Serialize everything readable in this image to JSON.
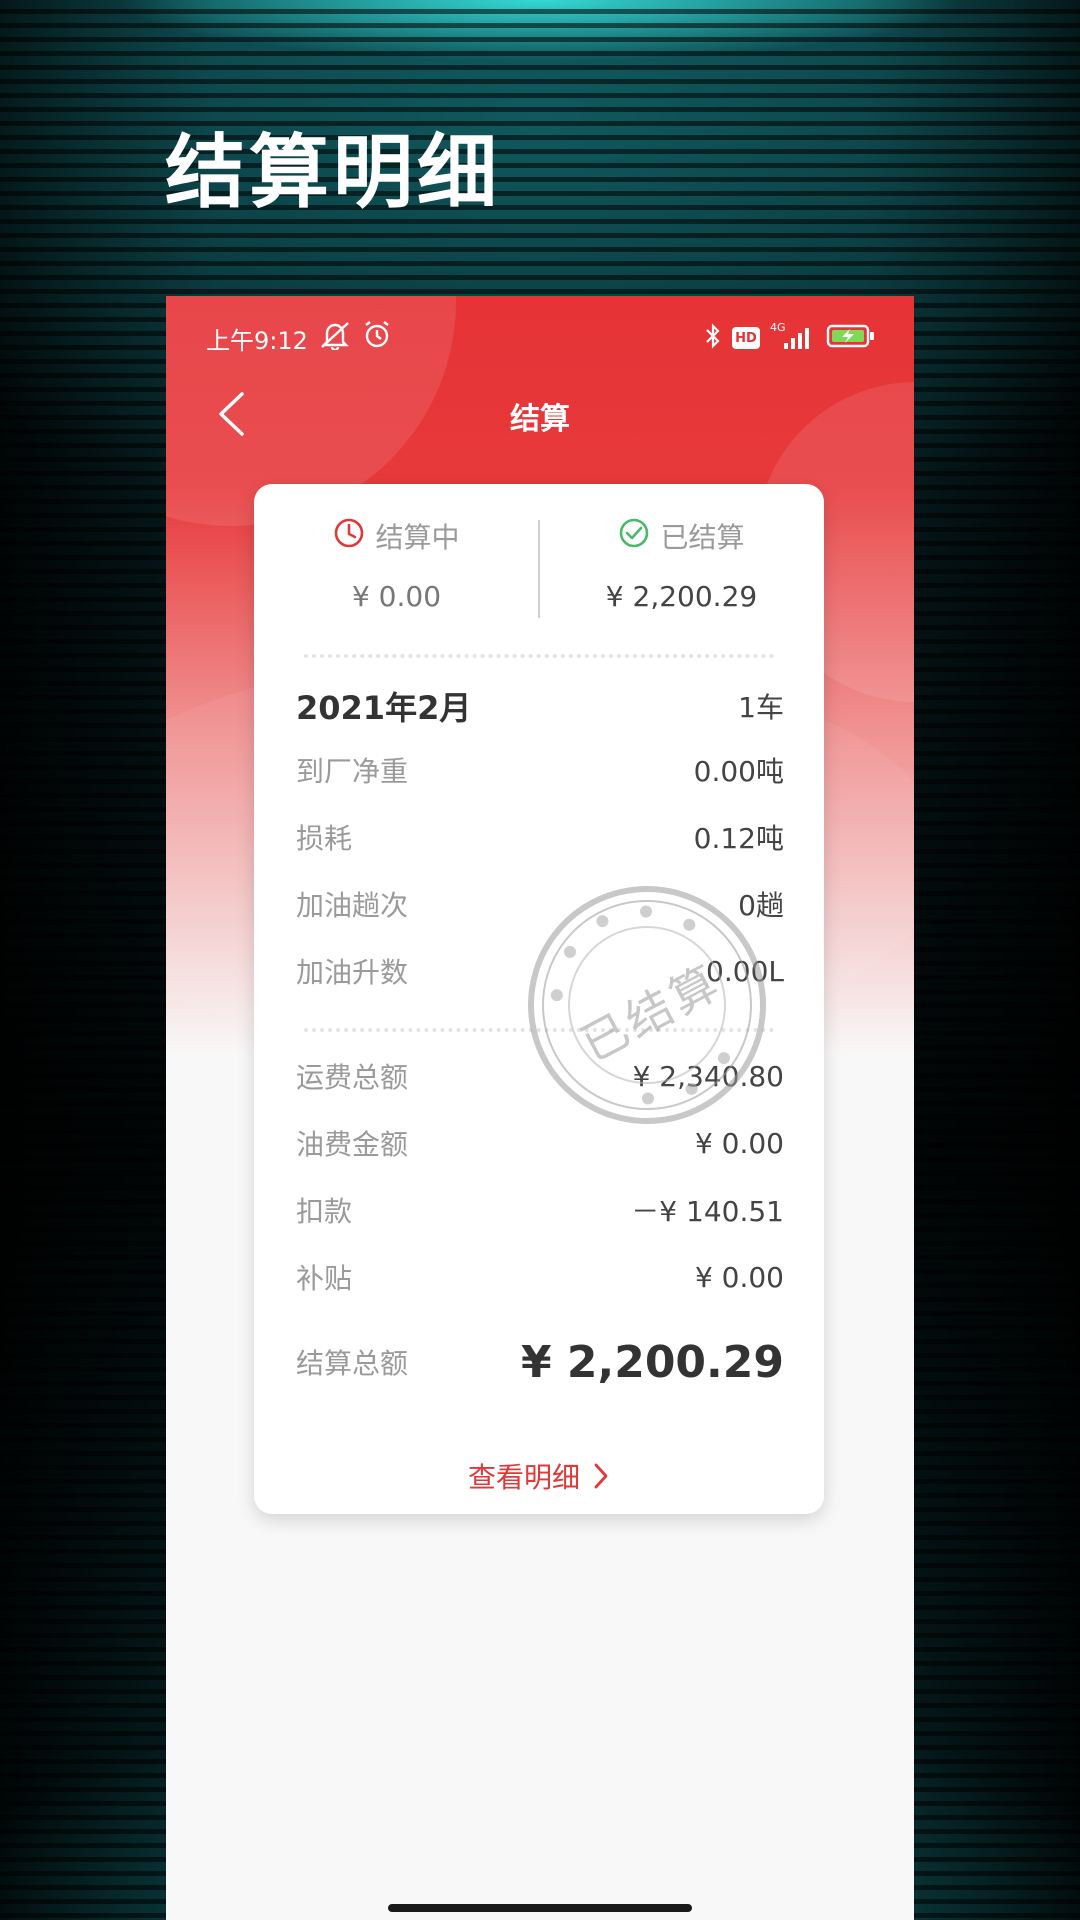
{
  "promo": {
    "title": "结算明细"
  },
  "status_bar": {
    "time": "上午9:12",
    "network": "4G",
    "hd": "HD"
  },
  "nav": {
    "title": "结算"
  },
  "summary": {
    "pending_label": "结算中",
    "pending_value": "¥ 0.00",
    "settled_label": "已结算",
    "settled_value": "¥ 2,200.29"
  },
  "period": {
    "month": "2021年2月",
    "vehicles": "1车"
  },
  "details": [
    {
      "label": "到厂净重",
      "value": "0.00吨"
    },
    {
      "label": "损耗",
      "value": "0.12吨"
    },
    {
      "label": "加油趟次",
      "value": "0趟"
    },
    {
      "label": "加油升数",
      "value": "0.00L"
    }
  ],
  "amounts": [
    {
      "label": "运费总额",
      "value": "¥ 2,340.80"
    },
    {
      "label": "油费金额",
      "value": "¥ 0.00"
    },
    {
      "label": "扣款",
      "value": "－¥ 140.51"
    },
    {
      "label": "补贴",
      "value": "¥ 0.00"
    }
  ],
  "total": {
    "label": "结算总额",
    "value": "¥ 2,200.29"
  },
  "detail_link": "查看明细",
  "stamp": {
    "text": "已结算"
  },
  "colors": {
    "accent": "#e63336",
    "success": "#4cb86a",
    "link": "#e1383a"
  }
}
